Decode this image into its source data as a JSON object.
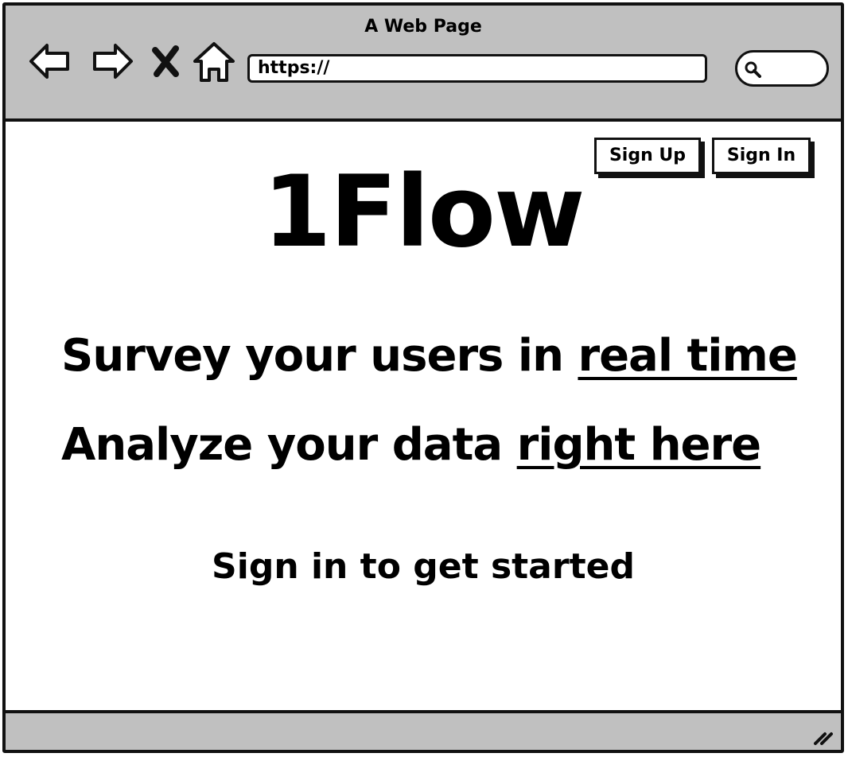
{
  "window": {
    "title": "A Web Page"
  },
  "toolbar": {
    "icons": [
      "back-arrow-icon",
      "forward-arrow-icon",
      "close-x-icon",
      "home-icon"
    ],
    "url_value": "https://",
    "search_icon": "search-icon"
  },
  "header": {
    "sign_up_label": "Sign Up",
    "sign_in_label": "Sign In"
  },
  "hero": {
    "brand": "1Flow",
    "line1_text": "Survey your users in ",
    "line1_link": "real time",
    "line2_text": "Analyze your data ",
    "line2_link": "right here",
    "cta": "Sign in to get started"
  },
  "colors": {
    "chrome": "#c0c0c0",
    "ink": "#111111",
    "page": "#ffffff"
  }
}
